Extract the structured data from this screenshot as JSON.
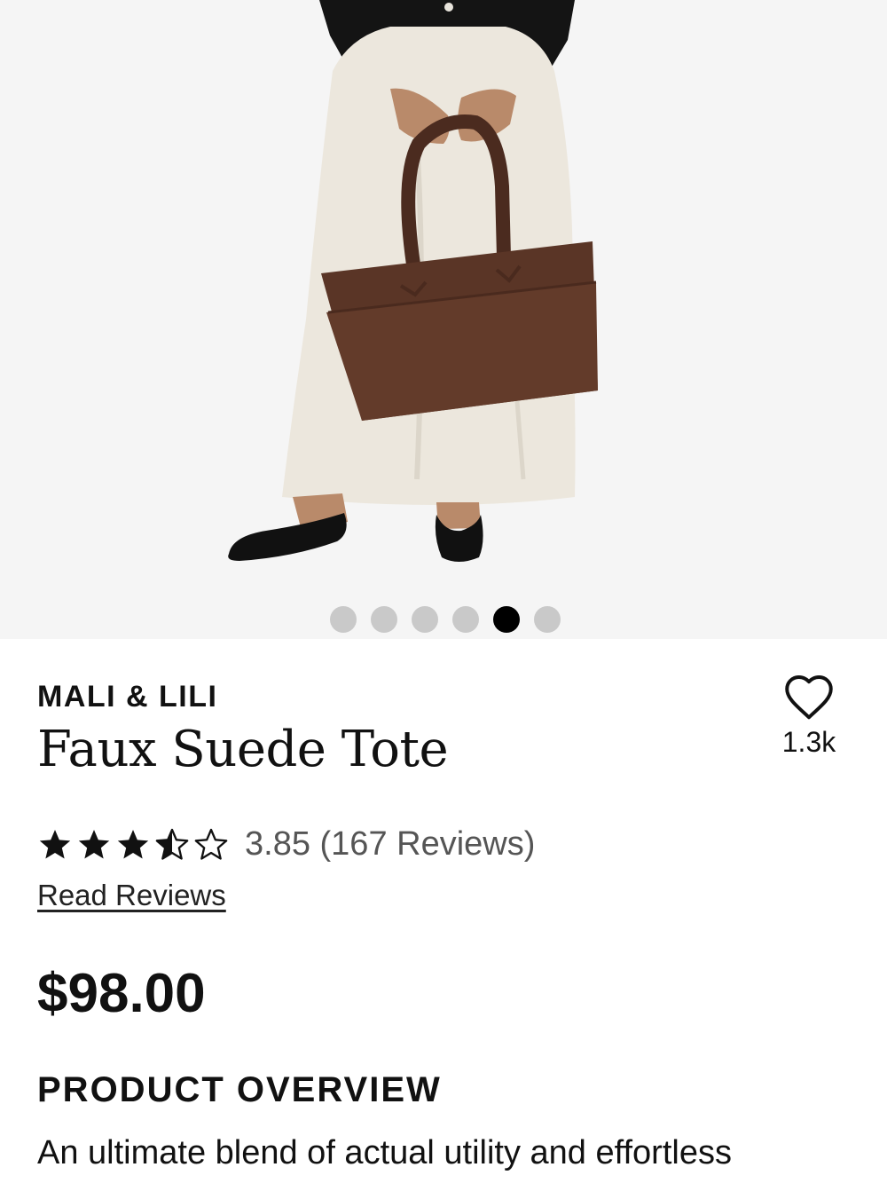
{
  "carousel": {
    "total_images": 6,
    "active_index": 4
  },
  "product": {
    "brand": "MALI & LILI",
    "name": "Faux Suede Tote",
    "favorites_count": "1.3k",
    "rating_value": 3.85,
    "rating_text": "3.85 (167 Reviews)",
    "read_reviews_label": "Read Reviews",
    "price": "$98.00"
  },
  "overview": {
    "heading": "PRODUCT OVERVIEW",
    "text": "An ultimate blend of actual utility and effortless"
  },
  "icons": {
    "favorite": "heart-outline-icon",
    "star_full": "star-filled-icon",
    "star_half": "star-half-icon",
    "star_empty": "star-outline-icon"
  },
  "colors": {
    "bag": "#5a3526",
    "skirt": "#ece7dd",
    "top": "#141414",
    "dot_active": "#000000",
    "dot_inactive": "#c9c9c9"
  }
}
